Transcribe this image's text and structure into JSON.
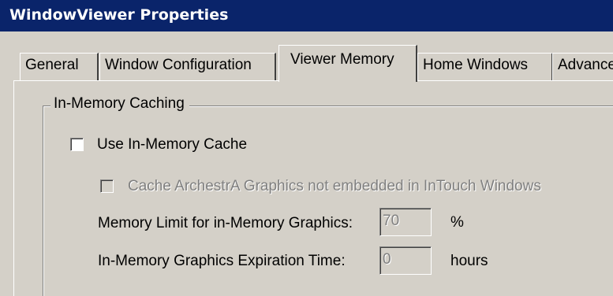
{
  "window": {
    "title": "WindowViewer Properties"
  },
  "tabs": [
    {
      "label": "General",
      "active": false
    },
    {
      "label": "Window Configuration",
      "active": false
    },
    {
      "label": "Viewer Memory",
      "active": true
    },
    {
      "label": "Home Windows",
      "active": false
    },
    {
      "label": "Advanced",
      "active": false
    }
  ],
  "group": {
    "title": "In-Memory Caching",
    "use_cache": {
      "label": "Use In-Memory Cache",
      "checked": false,
      "enabled": true
    },
    "cache_archestra": {
      "label": "Cache ArchestrA Graphics not embedded in InTouch Windows",
      "checked": false,
      "enabled": false
    },
    "memory_limit": {
      "label": "Memory Limit for in-Memory Graphics:",
      "value": "70",
      "unit": "%",
      "enabled": false
    },
    "expiration": {
      "label": "In-Memory Graphics Expiration Time:",
      "value": "0",
      "unit": "hours",
      "enabled": false
    }
  },
  "colors": {
    "titlebar": "#0a246a",
    "dialog_face": "#d4d0c8",
    "disabled_text": "#808080"
  }
}
